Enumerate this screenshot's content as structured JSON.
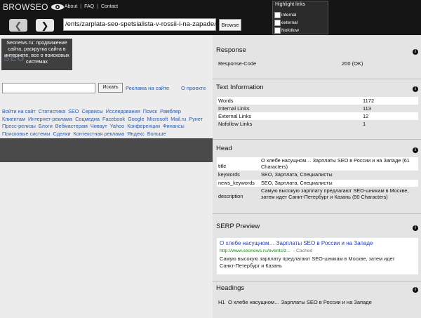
{
  "header": {
    "logo": "BROWSEO",
    "nav": [
      "About",
      "FAQ",
      "Contact"
    ],
    "highlight": {
      "title": "Highlight links",
      "options": [
        "internal",
        "external",
        "Nofollow"
      ]
    },
    "url": "/ents/zarplata-seo-spetsialista-v-rossii-i-na-zapade/",
    "browse_label": "Browse"
  },
  "left": {
    "banner_text": "Seonews.ru: продвижение сайта, раскрутка сайта в интернете, все о поисковых системах",
    "banner_logo": "SEO",
    "search_button": "Искать",
    "ad_link": "Реклама на сайте",
    "about_link": "О проекте",
    "links": [
      "Войти на сайт",
      "Статистика",
      "SEO",
      "Сервисы",
      "Исследования",
      "Поиск",
      "Рамблер",
      "Клиентам",
      "Интернет-реклама",
      "Соцмедиа",
      "Facebook",
      "Google",
      "Microsoft",
      "Mail.ru",
      "Рунет",
      "Пресс-релизы",
      "Блоги",
      "Вебмастерам",
      "Чиваут",
      "Yahoo",
      "Конференции",
      "Финансы",
      "Поисковые системы",
      "Сделки",
      "Контекстная реклама",
      "Яндекс",
      "Больше"
    ]
  },
  "response": {
    "title": "Response",
    "rows": [
      {
        "label": "Response-Code",
        "value": "200 (OK)"
      }
    ]
  },
  "text_info": {
    "title": "Text Information",
    "rows": [
      {
        "label": "Words",
        "value": "1172"
      },
      {
        "label": "Internal Links",
        "value": "113"
      },
      {
        "label": "External Links",
        "value": "12"
      },
      {
        "label": "Nofollow Links",
        "value": "1"
      }
    ]
  },
  "head": {
    "title": "Head",
    "rows": [
      {
        "label": "title",
        "value": "О хлебе насущном… Зарплаты SEO в России и на Западе (61 Characters)"
      },
      {
        "label": "keywords",
        "value": "SEO, Зарплата, Специалисты"
      },
      {
        "label": "news_keywords",
        "value": "SEO, Зарплата, Специалисты"
      },
      {
        "label": "description",
        "value": "Самую высокую зарплату предлагают SEO-шникам в Москве, затем идет Санкт-Петербург и Казань (90 Characters)"
      }
    ]
  },
  "serp": {
    "title": "SERP Preview",
    "result_title": "О хлебе насущном… Зарплаты SEO в России и на Западе",
    "result_url": "http://www.seonews.ru/events/z...",
    "cached": "- Cached",
    "result_desc": "Самую высокую зарплату предлагают SEO-шникам в Москве, затем идет Санкт-Петербург и Казань"
  },
  "headings": {
    "title": "Headings",
    "rows": [
      {
        "label": "H1",
        "value": "О хлебе насущном… Зарплаты SEO в России и на Западе"
      }
    ]
  },
  "icons": {
    "info": "info-icon",
    "back": "arrow-left-icon",
    "forward": "arrow-right-icon",
    "logo": "eye-icon"
  },
  "colors": {
    "header_bg": "#151515",
    "link": "#2a5db0",
    "serp_title": "#2a3fb0",
    "serp_url": "#1a8a1a"
  }
}
